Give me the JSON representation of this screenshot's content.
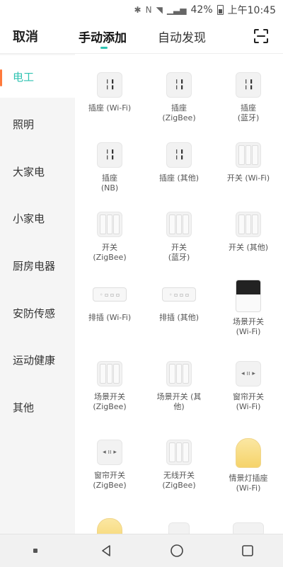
{
  "status_bar": {
    "battery": "42%",
    "time": "上午10:45"
  },
  "header": {
    "cancel_label": "取消",
    "tabs": [
      {
        "label": "手动添加",
        "active": true
      },
      {
        "label": "自动发现",
        "active": false
      }
    ]
  },
  "sidebar": {
    "items": [
      {
        "label": "电工",
        "active": true
      },
      {
        "label": "照明"
      },
      {
        "label": "大家电"
      },
      {
        "label": "小家电"
      },
      {
        "label": "厨房电器"
      },
      {
        "label": "安防传感"
      },
      {
        "label": "运动健康"
      },
      {
        "label": "其他"
      }
    ]
  },
  "devices": [
    {
      "label": "插座 (Wi-Fi)",
      "icon": "socket-icon"
    },
    {
      "label": "插座\n(ZigBee)",
      "icon": "socket-icon"
    },
    {
      "label": "插座\n(蓝牙)",
      "icon": "socket-icon"
    },
    {
      "label": "插座\n(NB)",
      "icon": "socket-icon"
    },
    {
      "label": "插座 (其他)",
      "icon": "socket-icon"
    },
    {
      "label": "开关 (Wi-Fi)",
      "icon": "switch-icon"
    },
    {
      "label": "开关\n(ZigBee)",
      "icon": "switch-icon"
    },
    {
      "label": "开关\n(蓝牙)",
      "icon": "switch-icon"
    },
    {
      "label": "开关 (其他)",
      "icon": "switch-icon"
    },
    {
      "label": "排插 (Wi-Fi)",
      "icon": "power-strip-icon"
    },
    {
      "label": "排插 (其他)",
      "icon": "power-strip-icon"
    },
    {
      "label": "场景开关\n(Wi-Fi)",
      "icon": "scene-panel-icon"
    },
    {
      "label": "场景开关\n(ZigBee)",
      "icon": "scene-switch-icon"
    },
    {
      "label": "场景开关 (其\n他)",
      "icon": "scene-switch-icon"
    },
    {
      "label": "窗帘开关\n(Wi-Fi)",
      "icon": "curtain-switch-icon"
    },
    {
      "label": "窗帘开关\n(ZigBee)",
      "icon": "curtain-switch-icon"
    },
    {
      "label": "无线开关\n(ZigBee)",
      "icon": "wireless-switch-icon"
    },
    {
      "label": "情景灯插座\n(Wi-Fi)",
      "icon": "mood-lamp-icon"
    }
  ],
  "colors": {
    "accent": "#2fc3b2",
    "indicator": "#ff7a3c"
  }
}
